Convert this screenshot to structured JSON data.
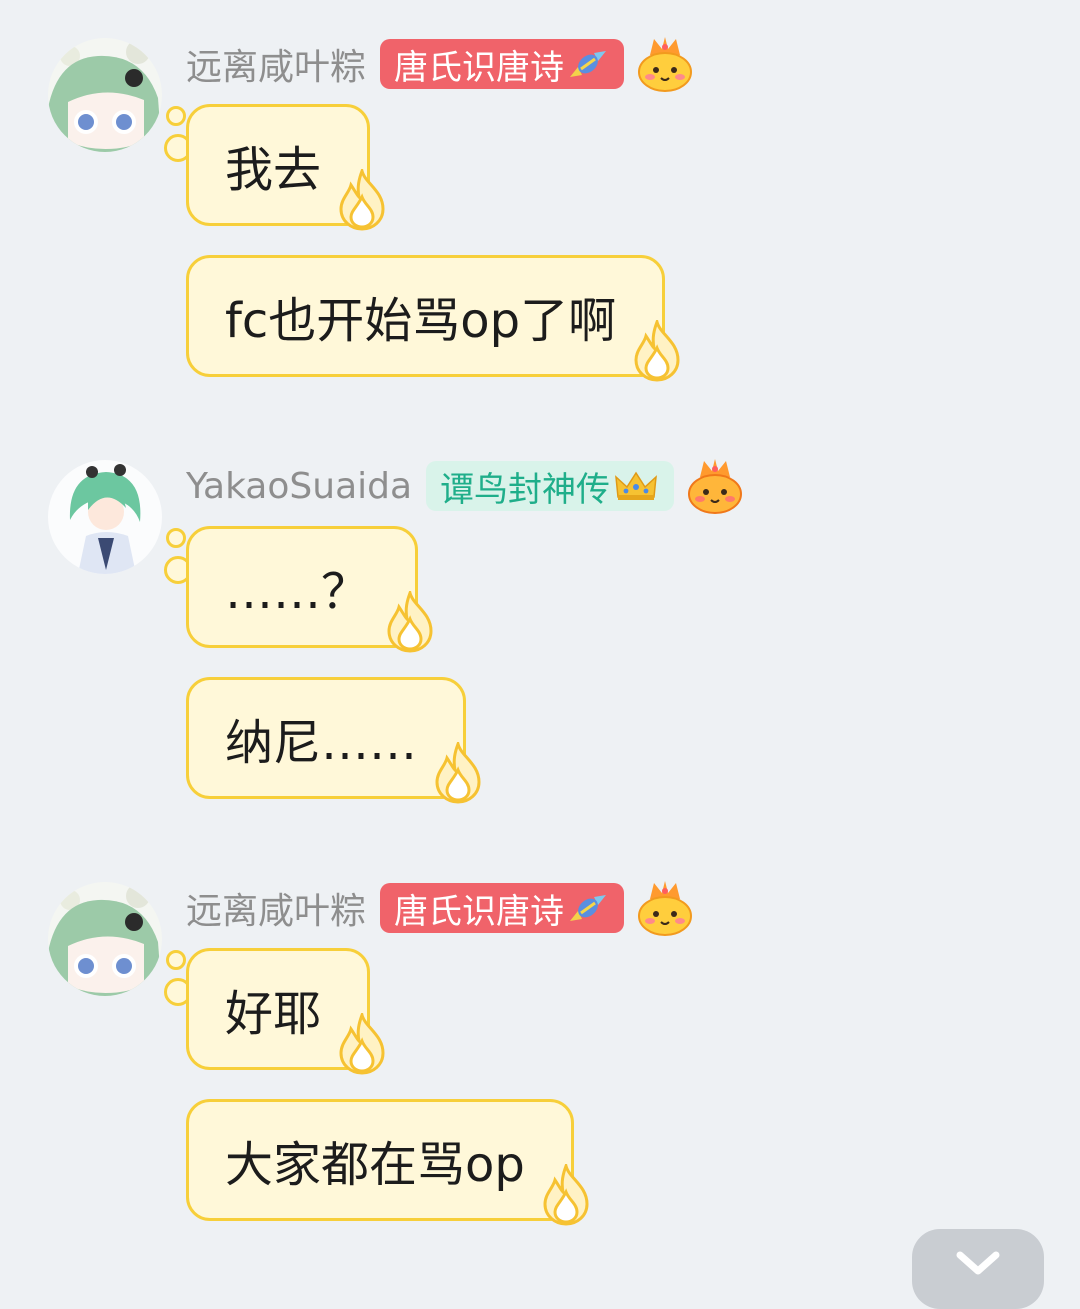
{
  "colors": {
    "background": "#eef1f4",
    "bubble_fill": "#fff8d9",
    "bubble_border": "#f7cf3a",
    "username": "#8e8e8e",
    "badge_red": "#f0636a",
    "badge_teal_bg": "#d9f3ea",
    "badge_teal_text": "#1fae8a"
  },
  "groups": [
    {
      "user": "远离咸叶粽",
      "badge": "唐氏识唐诗",
      "badge_style": "red",
      "badge_icon": "candy-icon",
      "messages": [
        "我去",
        "fc也开始骂op了啊"
      ]
    },
    {
      "user": "YakaoSuaida",
      "badge": "谭鸟封神传",
      "badge_style": "teal",
      "badge_icon": "crown-icon",
      "messages": [
        "……？",
        "纳尼……"
      ]
    },
    {
      "user": "远离咸叶粽",
      "badge": "唐氏识唐诗",
      "badge_style": "red",
      "badge_icon": "candy-icon",
      "messages": [
        "好耶",
        "大家都在骂op"
      ]
    }
  ],
  "scroll_button_icon": "chevron-down-icon"
}
